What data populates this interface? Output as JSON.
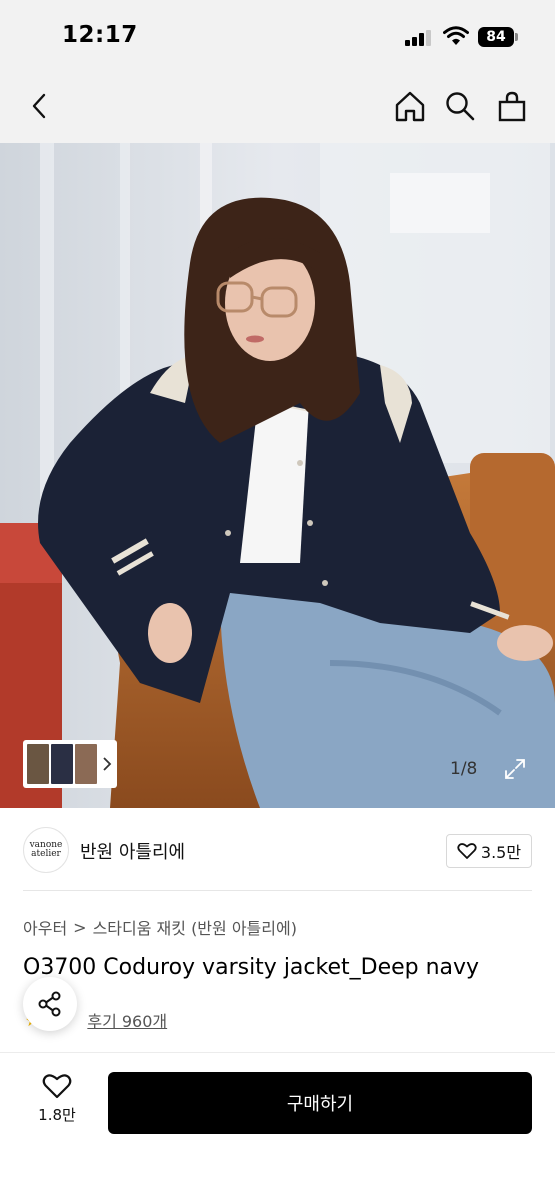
{
  "status_bar": {
    "time": "12:17",
    "battery": "84"
  },
  "nav": {
    "back_icon": "chevron-left-icon",
    "home_icon": "home-icon",
    "search_icon": "search-icon",
    "cart_icon": "shopping-bag-icon"
  },
  "gallery": {
    "counter": "1/8",
    "expand_icon": "expand-icon"
  },
  "store": {
    "logo_line1": "vanone",
    "logo_line2": "atelier",
    "name": "반원 아틀리에",
    "likes": "3.5만"
  },
  "breadcrumb": {
    "category": "아우터",
    "separator": ">",
    "subcategory": "스타디움 재킷 (반원 아틀리에)"
  },
  "product": {
    "title": "O3700 Coduroy varsity jacket_Deep navy"
  },
  "reviews": {
    "rating": "",
    "link": "후기 960개"
  },
  "bottom_bar": {
    "wish_count": "1.8만",
    "buy_label": "구매하기"
  },
  "colors": {
    "accent": "#000000",
    "star": "#f5b800",
    "jacket": "#1b2236"
  }
}
